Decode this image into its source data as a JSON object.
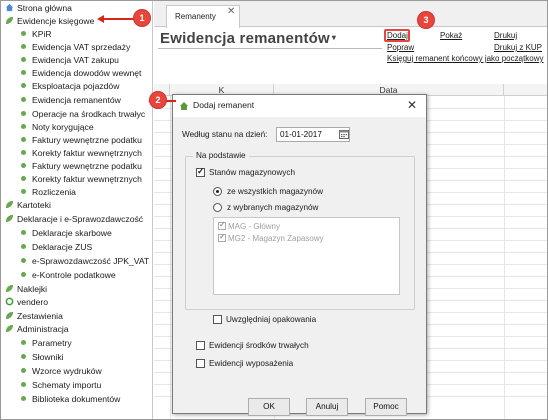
{
  "sidebar": {
    "items": [
      {
        "label": "Strona główna",
        "level": 0,
        "icon": "home-icon"
      },
      {
        "label": "Ewidencje księgowe",
        "level": 0,
        "icon": "leaf-icon"
      },
      {
        "label": "KPiR",
        "level": 1
      },
      {
        "label": "Ewidencja VAT sprzedaży",
        "level": 1
      },
      {
        "label": "Ewidencja VAT zakupu",
        "level": 1
      },
      {
        "label": "Ewidencja dowodów wewnęt",
        "level": 1
      },
      {
        "label": "Eksploatacja pojazdów",
        "level": 1
      },
      {
        "label": "Ewidencja remanentów",
        "level": 1
      },
      {
        "label": "Operacje na środkach trwałyc",
        "level": 1
      },
      {
        "label": "Noty korygujące",
        "level": 1
      },
      {
        "label": "Faktury wewnętrzne podatku",
        "level": 1
      },
      {
        "label": "Korekty faktur wewnętrznych",
        "level": 1
      },
      {
        "label": "Faktury wewnętrzne podatku",
        "level": 1
      },
      {
        "label": "Korekty faktur wewnętrznych",
        "level": 1
      },
      {
        "label": "Rozliczenia",
        "level": 1
      },
      {
        "label": "Kartoteki",
        "level": 0,
        "icon": "leaf-icon"
      },
      {
        "label": "Deklaracje i e-Sprawozdawczość",
        "level": 0,
        "icon": "leaf-icon"
      },
      {
        "label": "Deklaracje skarbowe",
        "level": 1
      },
      {
        "label": "Deklaracje ZUS",
        "level": 1
      },
      {
        "label": "e-Sprawozdawczość JPK_VAT",
        "level": 1
      },
      {
        "label": "e-Kontrole podatkowe",
        "level": 1
      },
      {
        "label": "Naklejki",
        "level": 0,
        "icon": "leaf-icon"
      },
      {
        "label": "vendero",
        "level": 0,
        "icon": "vendero-icon"
      },
      {
        "label": "Zestawienia",
        "level": 0,
        "icon": "leaf-icon"
      },
      {
        "label": "Administracja",
        "level": 0,
        "icon": "leaf-icon"
      },
      {
        "label": "Parametry",
        "level": 1
      },
      {
        "label": "Słowniki",
        "level": 1
      },
      {
        "label": "Wzorce wydruków",
        "level": 1
      },
      {
        "label": "Schematy importu",
        "level": 1
      },
      {
        "label": "Biblioteka dokumentów",
        "level": 1
      }
    ]
  },
  "tab": {
    "label": "Remanenty"
  },
  "header": {
    "title": "Ewidencja remanentów",
    "actions": {
      "dodaj": "Dodaj",
      "pokaz": "Pokaż",
      "drukuj": "Drukuj",
      "popraw": "Popraw",
      "drukuj_kup": "Drukuj z KUP",
      "ksieguj": "Księguj remanent końcowy jako początkowy"
    }
  },
  "grid": {
    "columns": [
      "K",
      "Data"
    ]
  },
  "dialog": {
    "title": "Dodaj remanent",
    "date_label": "Według stanu na dzień:",
    "date_value": "01-01-2017",
    "group_title": "Na podstawie",
    "stany_label": "Stanów magazynowych",
    "radio_all": "ze wszystkich magazynów",
    "radio_selected": "z wybranych magazynów",
    "warehouses": [
      "MAG - Główny",
      "MG2 - Magazyn Zapasowy"
    ],
    "opakowania_label": "Uwzględniaj opakowania",
    "srodki_label": "Ewidencji środków trwałych",
    "wyposazenia_label": "Ewidencji wyposażenia",
    "ok": "OK",
    "anuluj": "Anuluj",
    "pomoc": "Pomoc"
  },
  "callouts": [
    "1",
    "2",
    "3"
  ],
  "colors": {
    "callout": "#e8453c",
    "arrow": "#d7281e",
    "tree_leaf": "#6aa84f"
  }
}
